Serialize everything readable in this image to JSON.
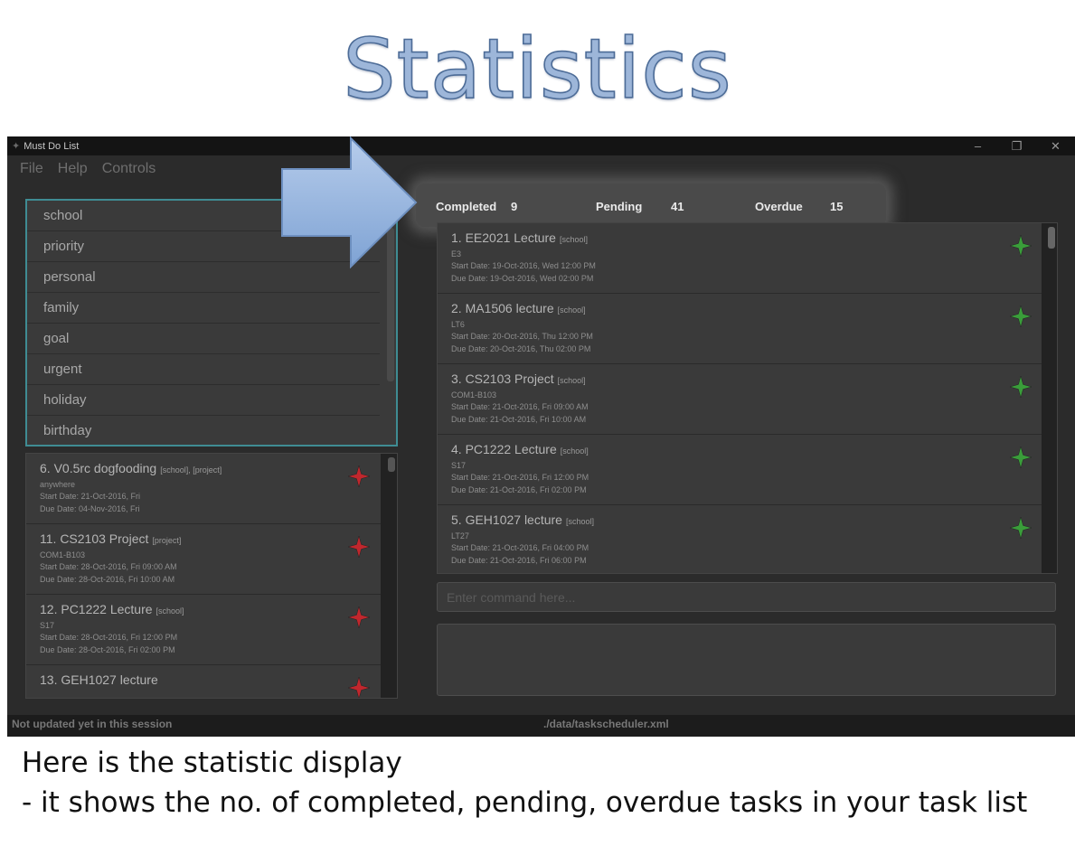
{
  "slide": {
    "title": "Statistics",
    "caption_line1": "Here is the statistic display",
    "caption_line2": "- it shows the no. of completed, pending, overdue tasks in your task list"
  },
  "window": {
    "title": "Must Do List",
    "controls": [
      "–",
      "❐",
      "✕"
    ]
  },
  "menu": {
    "file": "File",
    "help": "Help",
    "controls": "Controls"
  },
  "tags": [
    "school",
    "priority",
    "personal",
    "family",
    "goal",
    "urgent",
    "holiday",
    "birthday"
  ],
  "stats": {
    "completed_label": "Completed",
    "completed_value": "9",
    "pending_label": "Pending",
    "pending_value": "41",
    "overdue_label": "Overdue",
    "overdue_value": "15"
  },
  "left_tasks": [
    {
      "title": "6. V0.5rc dogfooding",
      "tags": "[school], [project]",
      "venue": "anywhere",
      "start": "Start Date: 21-Oct-2016, Fri",
      "due": "Due Date: 04-Nov-2016, Fri",
      "star": "red-star-icon"
    },
    {
      "title": "11. CS2103 Project",
      "tags": "[project]",
      "venue": "COM1-B103",
      "start": "Start Date: 28-Oct-2016, Fri 09:00 AM",
      "due": "Due Date: 28-Oct-2016, Fri 10:00 AM",
      "star": "red-star-icon"
    },
    {
      "title": "12. PC1222 Lecture",
      "tags": "[school]",
      "venue": "S17",
      "start": "Start Date: 28-Oct-2016, Fri 12:00 PM",
      "due": "Due Date: 28-Oct-2016, Fri 02:00 PM",
      "star": "red-star-icon"
    },
    {
      "title": "13. GEH1027 lecture",
      "tags": "",
      "venue": "",
      "start": "",
      "due": "",
      "star": "red-star-icon"
    }
  ],
  "right_tasks": [
    {
      "title": "1. EE2021 Lecture",
      "tags": "[school]",
      "venue": "E3",
      "start": "Start Date: 19-Oct-2016, Wed 12:00 PM",
      "due": "Due Date: 19-Oct-2016, Wed 02:00 PM",
      "star": "green-star-icon"
    },
    {
      "title": "2. MA1506 lecture",
      "tags": "[school]",
      "venue": "LT6",
      "start": "Start Date: 20-Oct-2016, Thu 12:00 PM",
      "due": "Due Date: 20-Oct-2016, Thu 02:00 PM",
      "star": "green-star-icon"
    },
    {
      "title": "3. CS2103 Project",
      "tags": "[school]",
      "venue": "COM1-B103",
      "start": "Start Date: 21-Oct-2016, Fri 09:00 AM",
      "due": "Due Date: 21-Oct-2016, Fri 10:00 AM",
      "star": "green-star-icon"
    },
    {
      "title": "4. PC1222 Lecture",
      "tags": "[school]",
      "venue": "S17",
      "start": "Start Date: 21-Oct-2016, Fri 12:00 PM",
      "due": "Due Date: 21-Oct-2016, Fri 02:00 PM",
      "star": "green-star-icon"
    },
    {
      "title": "5. GEH1027 lecture",
      "tags": "[school]",
      "venue": "LT27",
      "start": "Start Date: 21-Oct-2016, Fri 04:00 PM",
      "due": "Due Date: 21-Oct-2016, Fri 06:00 PM",
      "star": "green-star-icon"
    }
  ],
  "command": {
    "placeholder": "Enter command here..."
  },
  "status": {
    "left": "Not updated yet in this session",
    "right": "./data/taskscheduler.xml"
  },
  "colors": {
    "star_red": "#c0272d",
    "star_green": "#3a9d3a",
    "tag_border": "#3f8c93",
    "arrow_fill": "#8fb0db"
  }
}
